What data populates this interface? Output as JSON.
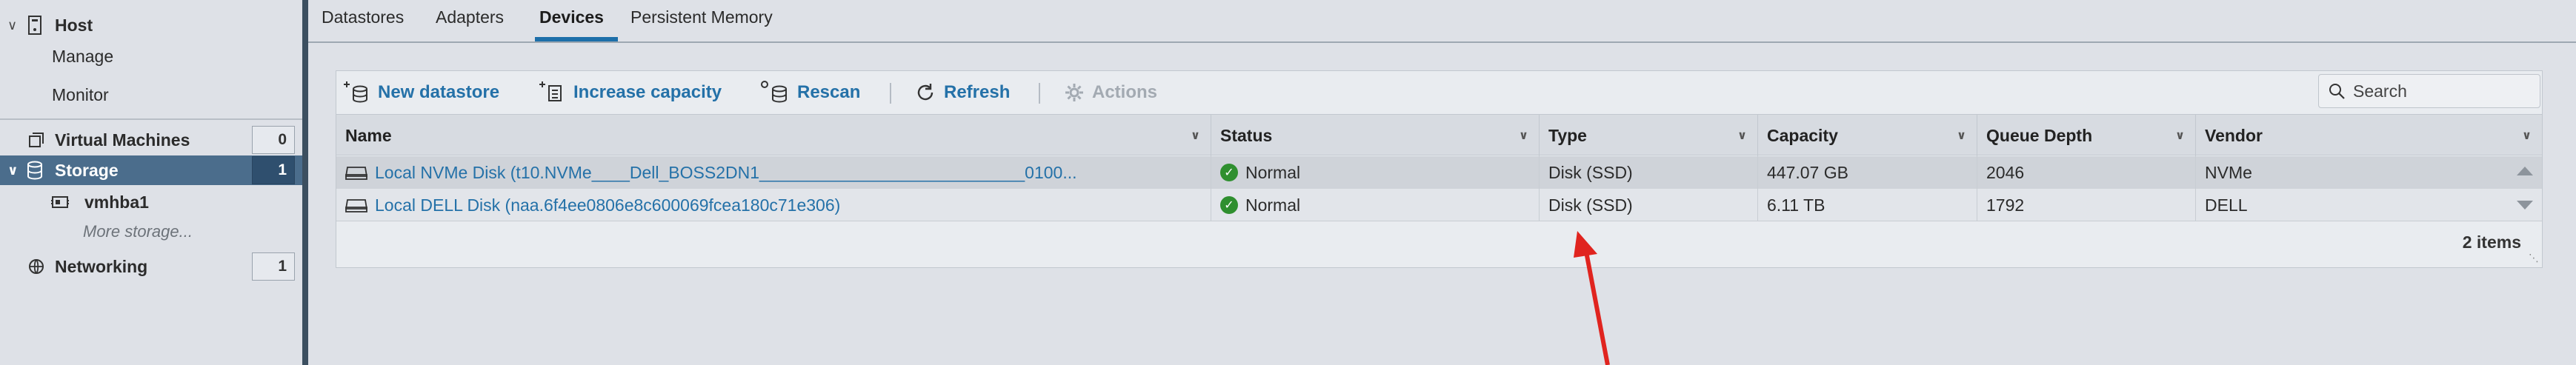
{
  "sidebar": {
    "host": {
      "label": "Host"
    },
    "manage": {
      "label": "Manage"
    },
    "monitor": {
      "label": "Monitor"
    },
    "virtual_machines": {
      "label": "Virtual Machines",
      "count": "0"
    },
    "storage": {
      "label": "Storage",
      "count": "1"
    },
    "vmhba1": {
      "label": "vmhba1"
    },
    "more_storage": {
      "label": "More storage..."
    },
    "networking": {
      "label": "Networking",
      "count": "1"
    }
  },
  "tabs": [
    {
      "label": "Datastores"
    },
    {
      "label": "Adapters"
    },
    {
      "label": "Devices"
    },
    {
      "label": "Persistent Memory"
    }
  ],
  "active_tab": "Devices",
  "toolbar": {
    "new_datastore": "New datastore",
    "increase_capacity": "Increase capacity",
    "rescan": "Rescan",
    "refresh": "Refresh",
    "actions": "Actions"
  },
  "search": {
    "placeholder": "Search"
  },
  "table": {
    "columns": [
      "Name",
      "Status",
      "Type",
      "Capacity",
      "Queue Depth",
      "Vendor"
    ],
    "rows": [
      {
        "name": "Local NVMe Disk (t10.NVMe____Dell_BOSS2DN1____________________________0100...",
        "status": "Normal",
        "type": "Disk (SSD)",
        "capacity": "447.07 GB",
        "queue_depth": "2046",
        "vendor": "NVMe"
      },
      {
        "name": "Local DELL Disk (naa.6f4ee0806e8c600069fcea180c71e306)",
        "status": "Normal",
        "type": "Disk (SSD)",
        "capacity": "6.11 TB",
        "queue_depth": "1792",
        "vendor": "DELL"
      }
    ],
    "item_count": "2 items"
  },
  "colors": {
    "link_blue": "#2471a8",
    "sidebar_selected": "#4b6d8c",
    "divider": "#3c4f60",
    "status_ok": "#2f8f2f",
    "annotation_arrow": "#e0241f"
  }
}
